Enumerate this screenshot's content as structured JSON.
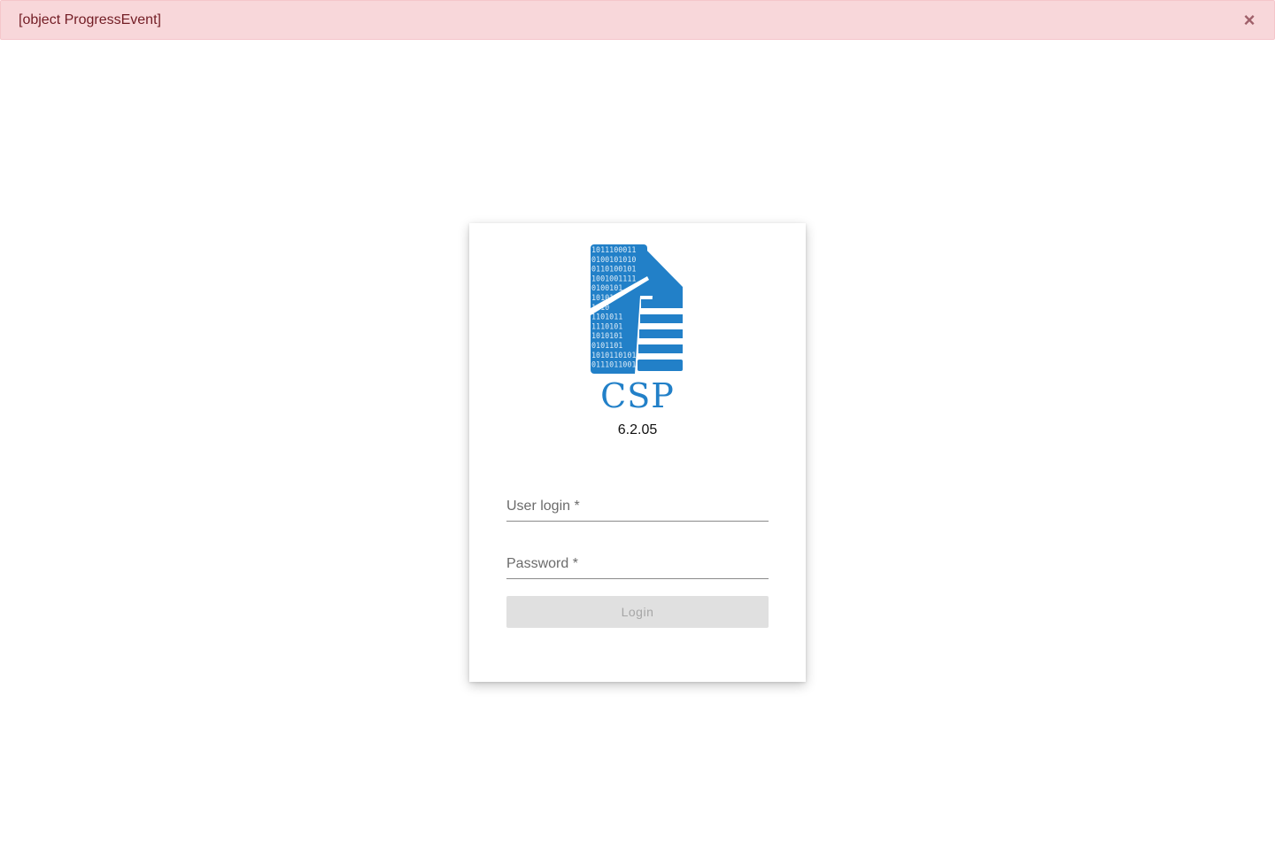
{
  "alert": {
    "message": "[object ProgressEvent]",
    "close_symbol": "×",
    "background": "#f8d7da",
    "text_color": "#721c24"
  },
  "login": {
    "app_name": "CSP",
    "version": "6.2.05",
    "logo_icon": "document-binary-icon",
    "brand_color": "#2280c8",
    "binary_rows": [
      "1011100011",
      "0100101010",
      "0110100101",
      "1001001111",
      "0100101",
      "10101",
      "1010",
      "1101011",
      "1110101",
      "1010101",
      "0101101",
      "1010110101",
      "0111011001"
    ],
    "user_login_label": "User login *",
    "password_label": "Password *",
    "login_button_label": "Login"
  }
}
